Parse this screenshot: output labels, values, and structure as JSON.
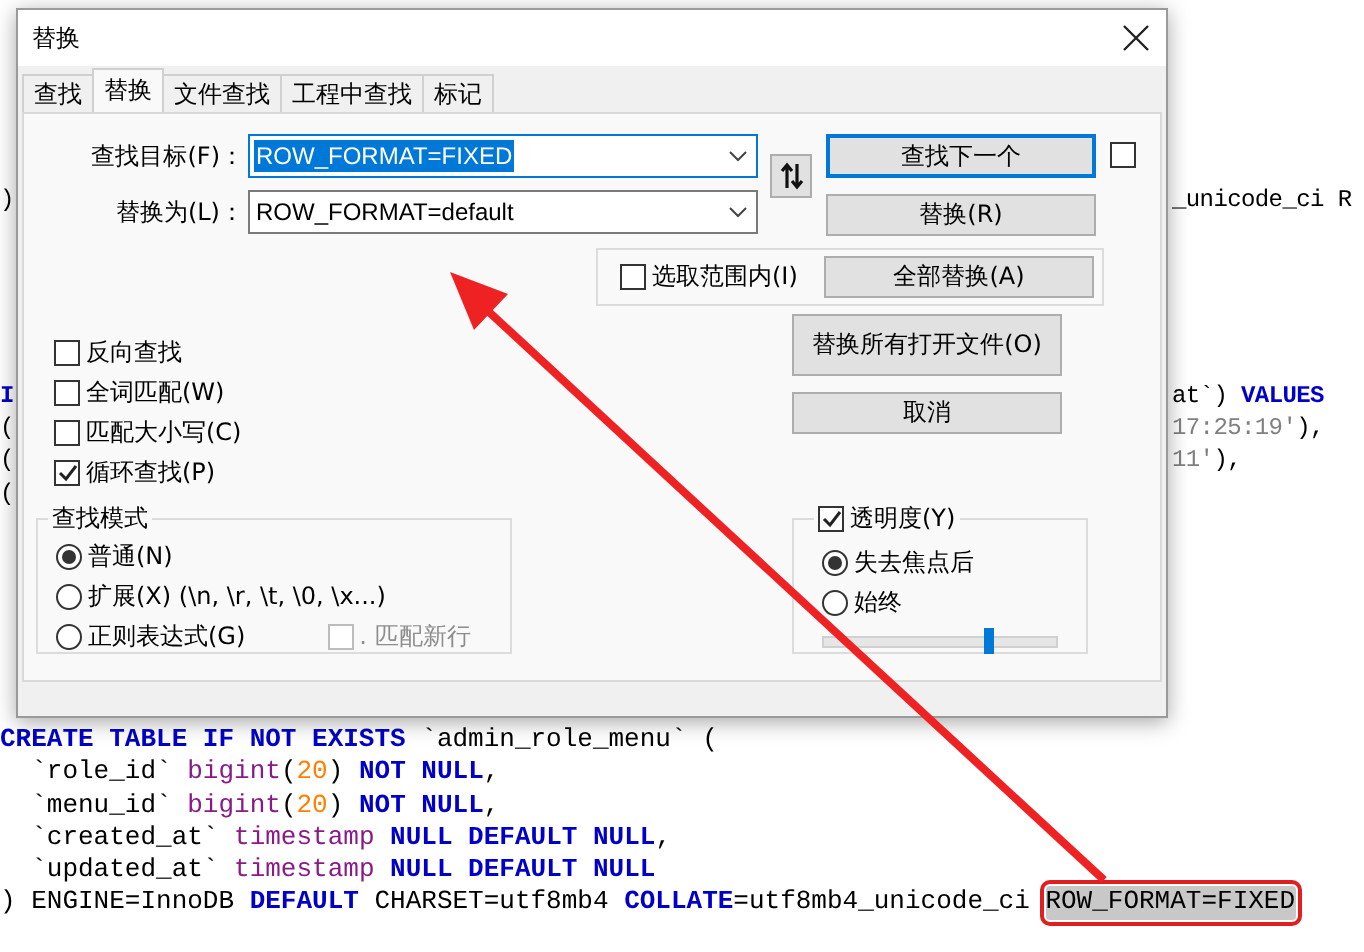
{
  "editor_behind": {
    "upper_lines": [
      {
        "left": [
          {
            "kind": "plain",
            "text": ")"
          }
        ],
        "right": [
          {
            "kind": "plain",
            "text": "_unicode_ci R"
          }
        ]
      },
      {
        "left": [
          {
            "kind": "kw",
            "text": "I"
          }
        ],
        "right": [
          {
            "kind": "plain",
            "text": "at`) "
          },
          {
            "kind": "kw",
            "text": "VALUES"
          }
        ]
      },
      {
        "left": [
          {
            "kind": "plain",
            "text": "("
          }
        ],
        "right": [
          {
            "kind": "str",
            "text": "17:25:19'"
          },
          {
            "kind": "plain",
            "text": "),"
          }
        ]
      },
      {
        "left": [
          {
            "kind": "plain",
            "text": "("
          }
        ],
        "right": [
          {
            "kind": "str",
            "text": "11'"
          },
          {
            "kind": "plain",
            "text": "),"
          }
        ]
      },
      {
        "left": [
          {
            "kind": "plain",
            "text": "("
          }
        ]
      }
    ],
    "lines": [
      [
        {
          "kind": "kw",
          "text": "CREATE TABLE IF NOT EXISTS"
        },
        {
          "kind": "plain",
          "text": " `admin_role_menu` ("
        }
      ],
      [
        {
          "kind": "plain",
          "text": "  `role_id` "
        },
        {
          "kind": "type",
          "text": "bigint"
        },
        {
          "kind": "plain",
          "text": "("
        },
        {
          "kind": "num",
          "text": "20"
        },
        {
          "kind": "plain",
          "text": ") "
        },
        {
          "kind": "kw",
          "text": "NOT NULL"
        },
        {
          "kind": "plain",
          "text": ","
        }
      ],
      [
        {
          "kind": "plain",
          "text": "  `menu_id` "
        },
        {
          "kind": "type",
          "text": "bigint"
        },
        {
          "kind": "plain",
          "text": "("
        },
        {
          "kind": "num",
          "text": "20"
        },
        {
          "kind": "plain",
          "text": ") "
        },
        {
          "kind": "kw",
          "text": "NOT NULL"
        },
        {
          "kind": "plain",
          "text": ","
        }
      ],
      [
        {
          "kind": "plain",
          "text": "  `created_at` "
        },
        {
          "kind": "type",
          "text": "timestamp"
        },
        {
          "kind": "kw",
          "text": " NULL DEFAULT NULL"
        },
        {
          "kind": "plain",
          "text": ","
        }
      ],
      [
        {
          "kind": "plain",
          "text": "  `updated_at` "
        },
        {
          "kind": "type",
          "text": "timestamp"
        },
        {
          "kind": "kw",
          "text": " NULL DEFAULT NULL"
        }
      ],
      [
        {
          "kind": "plain",
          "text": ") ENGINE=InnoDB "
        },
        {
          "kind": "kw",
          "text": "DEFAULT"
        },
        {
          "kind": "plain",
          "text": " CHARSET=utf8mb4 "
        },
        {
          "kind": "kw",
          "text": "COLLATE"
        },
        {
          "kind": "plain",
          "text": "=utf8mb4_unicode_ci "
        },
        {
          "kind": "match",
          "text": "ROW_FORMAT=FIXED"
        }
      ]
    ]
  },
  "dialog": {
    "title": "替换",
    "tabs": [
      {
        "label": "查找",
        "selected": false
      },
      {
        "label": "替换",
        "selected": true
      },
      {
        "label": "文件查找",
        "selected": false
      },
      {
        "label": "工程中查找",
        "selected": false
      },
      {
        "label": "标记",
        "selected": false
      }
    ],
    "find": {
      "label": "查找目标(F)：",
      "value": "ROW_FORMAT=FIXED",
      "text_selected": true
    },
    "replace": {
      "label": "替换为(L)：",
      "value": "ROW_FORMAT=default",
      "text_selected": false
    },
    "find_next": {
      "label": "查找下一个",
      "focused": true
    },
    "side_checkbox": {
      "checked": false
    },
    "replace_button": "替换(R)",
    "in_selection": {
      "label": "选取范围内(I)",
      "checked": false
    },
    "replace_all_button": "全部替换(A)",
    "replace_all_open_button": "替换所有打开文件(O)",
    "cancel_button": "取消",
    "options": [
      {
        "label": "反向查找",
        "checked": false
      },
      {
        "label": "全词匹配(W)",
        "checked": false
      },
      {
        "label": "匹配大小写(C)",
        "checked": false
      },
      {
        "label": "循环查找(P)",
        "checked": true
      }
    ],
    "search_mode": {
      "title": "查找模式",
      "modes": [
        {
          "label": "普通(N)",
          "selected": true
        },
        {
          "label": "扩展(X) (\\n, \\r, \\t, \\0, \\x...)",
          "selected": false
        },
        {
          "label": "正则表达式(G)",
          "selected": false
        }
      ],
      "dot_newline": {
        "label": ". 匹配新行",
        "checked": false,
        "disabled": true
      }
    },
    "transparency": {
      "label": "透明度(Y)",
      "checked": true,
      "modes": [
        {
          "label": "失去焦点后",
          "selected": true
        },
        {
          "label": "始终",
          "selected": false
        }
      ],
      "level": 0.71
    }
  }
}
